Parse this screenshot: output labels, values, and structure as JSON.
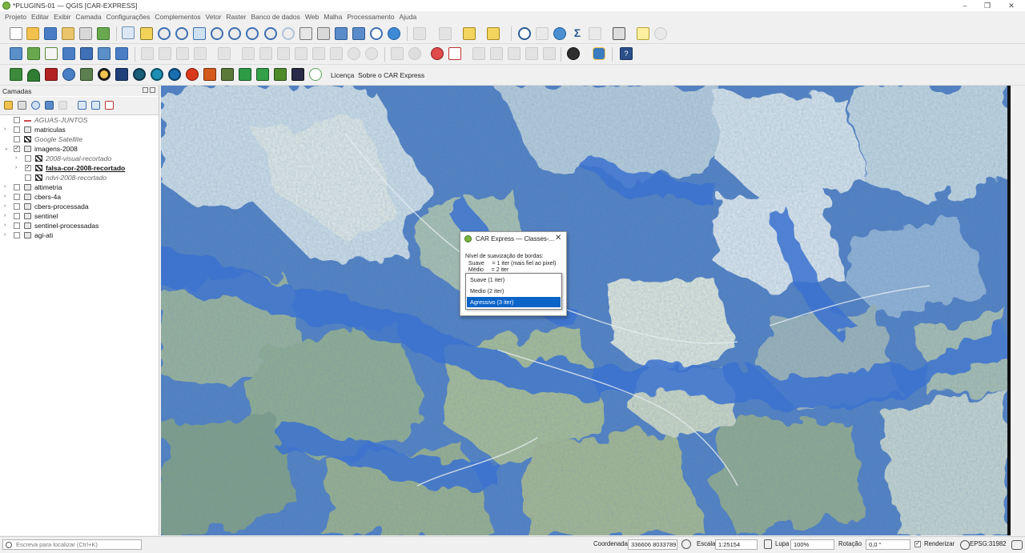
{
  "window": {
    "title": "*PLUGINS-01 — QGIS [CAR-EXPRESS]",
    "minimize": "–",
    "maximize": "❐",
    "close": "✕"
  },
  "menu": [
    "Projeto",
    "Editar",
    "Exibir",
    "Camada",
    "Configurações",
    "Complementos",
    "Vetor",
    "Raster",
    "Banco de dados",
    "Web",
    "Malha",
    "Processamento",
    "Ajuda"
  ],
  "plugin_toolbar": {
    "license_label": "Licença",
    "about_label": "Sobre o CAR Express"
  },
  "layers_panel": {
    "title": "Camadas",
    "layers": [
      {
        "name": "AGUAS-JUNTOS",
        "checked": false,
        "style": "it",
        "depth": 0,
        "expand": "",
        "icon": "line"
      },
      {
        "name": "matriculas",
        "checked": false,
        "style": "",
        "depth": 0,
        "expand": "›",
        "icon": "group"
      },
      {
        "name": "Google Satellite",
        "checked": false,
        "style": "it",
        "depth": 0,
        "expand": "",
        "icon": "raster"
      },
      {
        "name": "imagens-2008",
        "checked": true,
        "style": "",
        "depth": 0,
        "expand": "⌄",
        "icon": "group"
      },
      {
        "name": "2008-visual-recortado",
        "checked": false,
        "style": "it",
        "depth": 1,
        "expand": "›",
        "icon": "raster"
      },
      {
        "name": "falsa-cor-2008-recortado",
        "checked": true,
        "style": "bold",
        "depth": 1,
        "expand": "›",
        "icon": "raster"
      },
      {
        "name": "ndvi-2008-recortado",
        "checked": false,
        "style": "it",
        "depth": 1,
        "expand": "",
        "icon": "raster"
      },
      {
        "name": "altimetria",
        "checked": false,
        "style": "",
        "depth": 0,
        "expand": "›",
        "icon": "group"
      },
      {
        "name": "cbers-4a",
        "checked": false,
        "style": "",
        "depth": 0,
        "expand": "›",
        "icon": "group"
      },
      {
        "name": "cbers-processada",
        "checked": false,
        "style": "",
        "depth": 0,
        "expand": "›",
        "icon": "group"
      },
      {
        "name": "sentinel",
        "checked": false,
        "style": "",
        "depth": 0,
        "expand": "›",
        "icon": "group"
      },
      {
        "name": "sentinel-processadas",
        "checked": false,
        "style": "",
        "depth": 0,
        "expand": "›",
        "icon": "group"
      },
      {
        "name": "agi-ati",
        "checked": false,
        "style": "",
        "depth": 0,
        "expand": "›",
        "icon": "group"
      }
    ]
  },
  "dialog": {
    "title": "CAR Express — Classes-...",
    "close": "✕",
    "text_lines": [
      "Nível de suavização de bordas:",
      "  Suave     = 1 iter (mais fiel ao pixel)",
      "  Médio     = 2 iter"
    ],
    "options": [
      "Suave (1 iter)",
      "Medio (2 iter)",
      "Agressivo (3 iter)"
    ],
    "selected_index": 2
  },
  "statusbar": {
    "search_placeholder": "Escreva para localizar (Ctrl+K)",
    "coord_label": "Coordenada",
    "coord_value": "336606  8033789",
    "scale_label": "Escala",
    "scale_value": "1:25154",
    "magnifier_label": "Lupa",
    "magnifier_value": "100%",
    "rotation_label": "Rotação",
    "rotation_value": "0,0 °",
    "render_label": "Renderizar",
    "crs": "EPSG:31982"
  },
  "colors": {
    "accent_selection": "#0a64c8",
    "qgis_green": "#7cb342",
    "map_water_blue": "#3b72d0"
  }
}
